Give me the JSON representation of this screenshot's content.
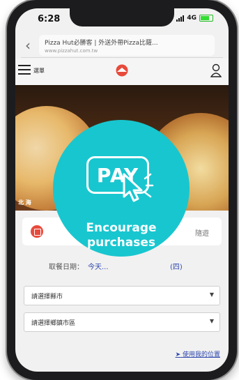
{
  "status": {
    "time": "6:28",
    "network": "4G"
  },
  "browser": {
    "page_title": "Pizza Hut必勝客 | 外送外帶Pizza比薩...",
    "url": "www.pizzahut.com.tw"
  },
  "nav": {
    "menu_label": "選單"
  },
  "hero": {
    "caption": "北 海"
  },
  "section": {
    "right_text": "隨遊"
  },
  "date": {
    "label": "取餐日期：",
    "value": "今天...",
    "day": "(四)"
  },
  "selects": [
    {
      "label": "請選擇縣市"
    },
    {
      "label": "請選擇鄉鎮市區"
    }
  ],
  "location_link": "使用我的位置",
  "overlay": {
    "pay_label": "PAY",
    "line1": "Encourage",
    "line2": "purchases"
  },
  "colors": {
    "badge": "#18c6cf",
    "link": "#2d47ad",
    "brand_red": "#e84a3b"
  }
}
